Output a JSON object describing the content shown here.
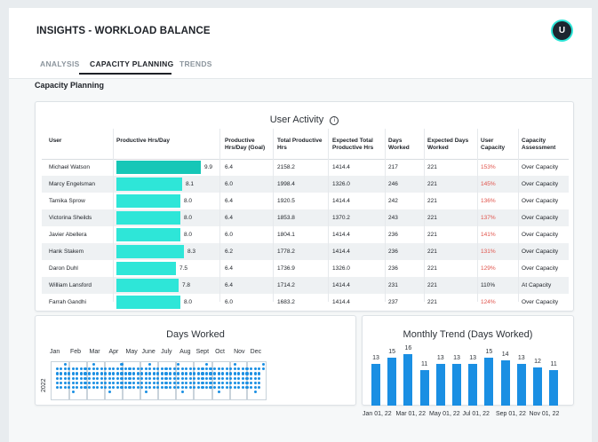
{
  "header": {
    "title": "INSIGHTS - WORKLOAD BALANCE",
    "avatar_initial": "U"
  },
  "tabs": [
    {
      "label": "ANALYSIS",
      "active": false
    },
    {
      "label": "CAPACITY PLANNING",
      "active": true
    },
    {
      "label": "TRENDS",
      "active": false
    }
  ],
  "section_title": "Capacity Planning",
  "user_activity": {
    "title": "User Activity",
    "info_icon": "info-circle-icon",
    "columns": [
      "User",
      "Productive Hrs/Day",
      "Productive Hrs/Day (Goal)",
      "Total Productive Hrs",
      "Expected Total Productive Hrs",
      "Days Worked",
      "Expected Days Worked",
      "User Capacity",
      "Capacity Assessment"
    ],
    "bar_max": 10,
    "over_color": "#e0524a",
    "rows": [
      {
        "user": "Michael Watson",
        "hrs": 9.9,
        "hrs_label": "9.9",
        "goal": "6.4",
        "total": "2158.2",
        "expected_total": "1414.4",
        "days": "217",
        "expected_days": "221",
        "capacity": "153%",
        "assessment": "Over Capacity",
        "over": true
      },
      {
        "user": "Marcy Engelsman",
        "hrs": 8.1,
        "hrs_label": "8.1",
        "goal": "6.0",
        "total": "1998.4",
        "expected_total": "1326.0",
        "days": "246",
        "expected_days": "221",
        "capacity": "145%",
        "assessment": "Over Capacity",
        "over": true
      },
      {
        "user": "Tamika Sprow",
        "hrs": 8.0,
        "hrs_label": "8.0",
        "goal": "6.4",
        "total": "1920.5",
        "expected_total": "1414.4",
        "days": "242",
        "expected_days": "221",
        "capacity": "136%",
        "assessment": "Over Capacity",
        "over": true
      },
      {
        "user": "Victorina Sheilds",
        "hrs": 8.0,
        "hrs_label": "8.0",
        "goal": "6.4",
        "total": "1853.8",
        "expected_total": "1370.2",
        "days": "243",
        "expected_days": "221",
        "capacity": "137%",
        "assessment": "Over Capacity",
        "over": true
      },
      {
        "user": "Javier Abellera",
        "hrs": 8.0,
        "hrs_label": "8.0",
        "goal": "6.0",
        "total": "1804.1",
        "expected_total": "1414.4",
        "days": "236",
        "expected_days": "221",
        "capacity": "141%",
        "assessment": "Over Capacity",
        "over": true
      },
      {
        "user": "Hank Stakem",
        "hrs": 8.3,
        "hrs_label": "8.3",
        "goal": "6.2",
        "total": "1778.2",
        "expected_total": "1414.4",
        "days": "236",
        "expected_days": "221",
        "capacity": "131%",
        "assessment": "Over Capacity",
        "over": true
      },
      {
        "user": "Daron Duhl",
        "hrs": 7.5,
        "hrs_label": "7.5",
        "goal": "6.4",
        "total": "1736.9",
        "expected_total": "1326.0",
        "days": "236",
        "expected_days": "221",
        "capacity": "129%",
        "assessment": "Over Capacity",
        "over": true
      },
      {
        "user": "William Lansford",
        "hrs": 7.8,
        "hrs_label": "7.8",
        "goal": "6.4",
        "total": "1714.2",
        "expected_total": "1414.4",
        "days": "231",
        "expected_days": "221",
        "capacity": "110%",
        "assessment": "At Capacity",
        "over": false
      },
      {
        "user": "Farrah Gandhi",
        "hrs": 8.0,
        "hrs_label": "8.0",
        "goal": "6.0",
        "total": "1683.2",
        "expected_total": "1414.4",
        "days": "237",
        "expected_days": "221",
        "capacity": "124%",
        "assessment": "Over Capacity",
        "over": true
      }
    ]
  },
  "days_worked": {
    "title": "Days Worked",
    "year": "2022",
    "months": [
      "Jan",
      "Feb",
      "Mar",
      "Apr",
      "May",
      "June",
      "July",
      "Aug",
      "Sept",
      "Oct",
      "Nov",
      "Dec"
    ],
    "dot_color": "#1a8fe3"
  },
  "monthly_trend": {
    "title": "Monthly Trend (Days Worked)",
    "values": [
      13,
      15,
      16,
      11,
      13,
      13,
      13,
      15,
      14,
      13,
      12,
      11
    ],
    "x_labels": [
      "Jan 01, 22",
      "Mar 01, 22",
      "May 01, 22",
      "Jul 01, 22",
      "Sep 01, 22",
      "Nov 01, 22"
    ],
    "bar_color": "#1a8fe3"
  }
}
